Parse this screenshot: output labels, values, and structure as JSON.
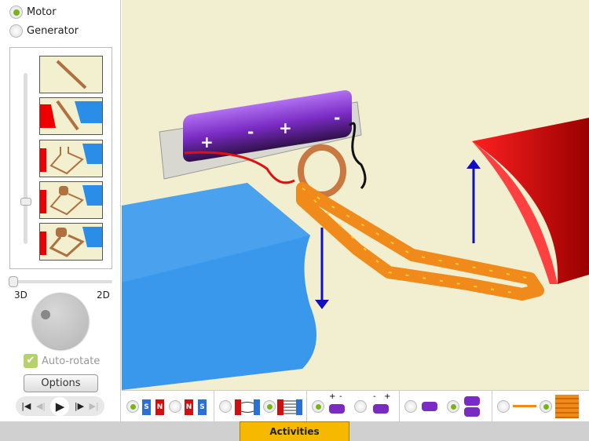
{
  "mode": {
    "options": [
      {
        "label": "Motor",
        "selected": true
      },
      {
        "label": "Generator",
        "selected": false
      }
    ]
  },
  "view": {
    "label_3d": "3D",
    "label_2d": "2D",
    "auto_rotate_label": "Auto-rotate",
    "auto_rotate_checked": true,
    "options_label": "Options"
  },
  "thumbnails": [
    "wire",
    "wire-with-magnets",
    "loop-with-magnets",
    "coil-with-magnets",
    "coil-and-loop-with-magnets"
  ],
  "playback": {
    "buttons": [
      "skip-start",
      "step-back",
      "play",
      "step-forward",
      "skip-end"
    ]
  },
  "battery": {
    "plus": "+",
    "minus": "-"
  },
  "toolbar": {
    "magnet_s": "S",
    "magnet_n": "N",
    "plus": "+",
    "minus": "-"
  },
  "footer": {
    "activities_label": "Activities"
  },
  "colors": {
    "accent_green": "#7ab317",
    "activities": "#f6b900",
    "magnet_red": "#e00",
    "magnet_blue": "#2a8ee8",
    "coil": "#f08a1a",
    "battery": "#7a2bc4",
    "force_arrow": "#1010c0"
  }
}
